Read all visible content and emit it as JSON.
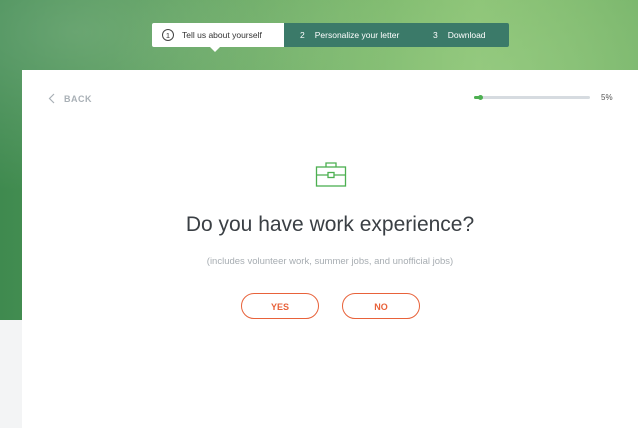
{
  "stepper": {
    "steps": [
      {
        "number": "1",
        "label": "Tell us about yourself",
        "state": "active"
      },
      {
        "number": "2",
        "label": "Personalize your letter",
        "state": "inactive"
      },
      {
        "number": "3",
        "label": "Download",
        "state": "inactive"
      }
    ]
  },
  "nav": {
    "back_label": "BACK",
    "back_icon": "chevron-left-icon"
  },
  "progress": {
    "percent_value": 5,
    "label": "5%"
  },
  "question": {
    "icon": "briefcase-icon",
    "title": "Do you have work experience?",
    "subtitle": "(includes volunteer work, summer jobs, and unofficial jobs)"
  },
  "answers": {
    "yes_label": "YES",
    "no_label": "NO"
  },
  "colors": {
    "accent_orange": "#e8623a",
    "progress_green": "#4caf50",
    "step_inactive_bg": "#3b7a69",
    "icon_green": "#4caf50"
  }
}
